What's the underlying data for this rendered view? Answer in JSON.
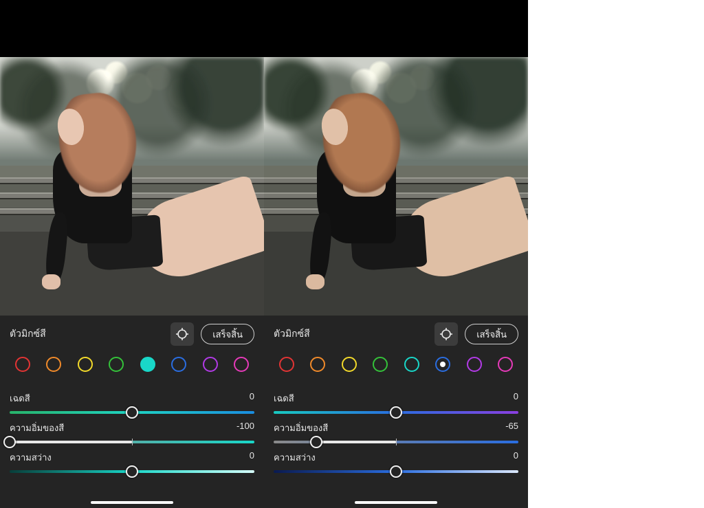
{
  "swatchColors": [
    "#e23434",
    "#f08a2a",
    "#f2d92a",
    "#34c23a",
    "#19d7c8",
    "#2a6de0",
    "#b23ae6",
    "#e63ab9"
  ],
  "leftPanel": {
    "title": "ตัวมิกซ์สี",
    "doneLabel": "เสร็จสิ้น",
    "selectedSwatchIndex": 4,
    "selectionStyle": "fill",
    "sliders": {
      "hue": {
        "label": "เฉดสี",
        "value": 0,
        "min": -100,
        "max": 100,
        "gradClass": "grad-aqua-hue"
      },
      "saturation": {
        "label": "ความอิ่มของสี",
        "value": -100,
        "min": -100,
        "max": 100,
        "gradClass": "grad-aqua-sat"
      },
      "luminance": {
        "label": "ความสว่าง",
        "value": 0,
        "min": -100,
        "max": 100,
        "gradClass": "grad-aqua-lum"
      }
    }
  },
  "rightPanel": {
    "title": "ตัวมิกซ์สี",
    "doneLabel": "เสร็จสิ้น",
    "selectedSwatchIndex": 5,
    "selectionStyle": "dot",
    "sliders": {
      "hue": {
        "label": "เฉดสี",
        "value": 0,
        "min": -100,
        "max": 100,
        "gradClass": "grad-blue-hue"
      },
      "saturation": {
        "label": "ความอิ่มของสี",
        "value": -65,
        "min": -100,
        "max": 100,
        "gradClass": "grad-blue-sat"
      },
      "luminance": {
        "label": "ความสว่าง",
        "value": 0,
        "min": -100,
        "max": 100,
        "gradClass": "grad-blue-lum"
      }
    }
  }
}
